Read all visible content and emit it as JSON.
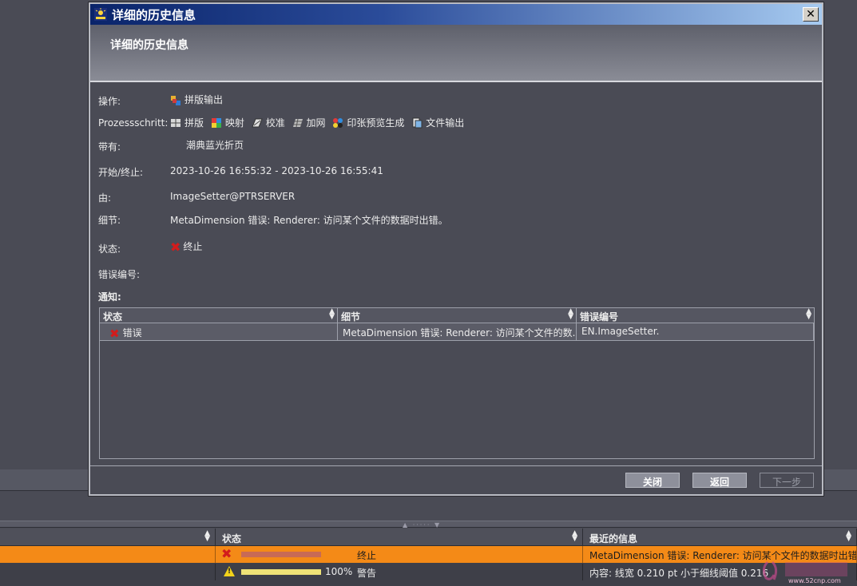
{
  "dialog": {
    "title": "详细的历史信息",
    "header_title": "详细的历史信息",
    "close_glyph": "✕",
    "fields": {
      "operation_label": "操作:",
      "operation_value": "拼版输出",
      "steps_label": "Prozessschritt:",
      "steps": [
        {
          "label": "拼版",
          "icon": "imposition-icon"
        },
        {
          "label": "映射",
          "icon": "mapping-icon"
        },
        {
          "label": "校准",
          "icon": "calibration-icon"
        },
        {
          "label": "加网",
          "icon": "screening-icon"
        },
        {
          "label": "印张预览生成",
          "icon": "sheet-preview-icon"
        },
        {
          "label": "文件输出",
          "icon": "file-output-icon"
        }
      ],
      "with_label": "带有:",
      "with_value": "潮典蓝光折页",
      "time_label": "开始/终止:",
      "time_value": "2023-10-26 16:55:32 - 2023-10-26 16:55:41",
      "by_label": "由:",
      "by_value": "ImageSetter@PTRSERVER",
      "detail_label": "细节:",
      "detail_value": "MetaDimension 错误: Renderer: 访问某个文件的数据时出错。",
      "status_label": "状态:",
      "status_value": "终止",
      "error_no_label": "错误编号:"
    },
    "notice_label": "通知:",
    "notice_table": {
      "columns": [
        "状态",
        "细节",
        "错误编号"
      ],
      "rows": [
        {
          "status": "错误",
          "detail": "MetaDimension 错误: Renderer: 访问某个文件的数...",
          "error_no": "EN.ImageSetter."
        }
      ]
    },
    "buttons": {
      "close": "关闭",
      "back": "返回",
      "next": "下一步"
    }
  },
  "bottom_table": {
    "columns": [
      "状态",
      "最近的信息"
    ],
    "rows": [
      {
        "percent": "",
        "status": "终止",
        "message": "MetaDimension 错误: Renderer: 访问某个文件的数据时出错。",
        "progress": 1.0,
        "bar_color": "#c86a55"
      },
      {
        "percent": "100%",
        "status": "警告",
        "message": "内容: 线宽 0.210 pt 小于细线阈值 0.216",
        "progress": 1.0,
        "bar_color": "#eee277"
      }
    ]
  },
  "watermark_text": "www.52cnp.com",
  "colors": {
    "accent_orange": "#f48a17",
    "error_red": "#d21c1c",
    "title_blue": "#0a246a"
  }
}
